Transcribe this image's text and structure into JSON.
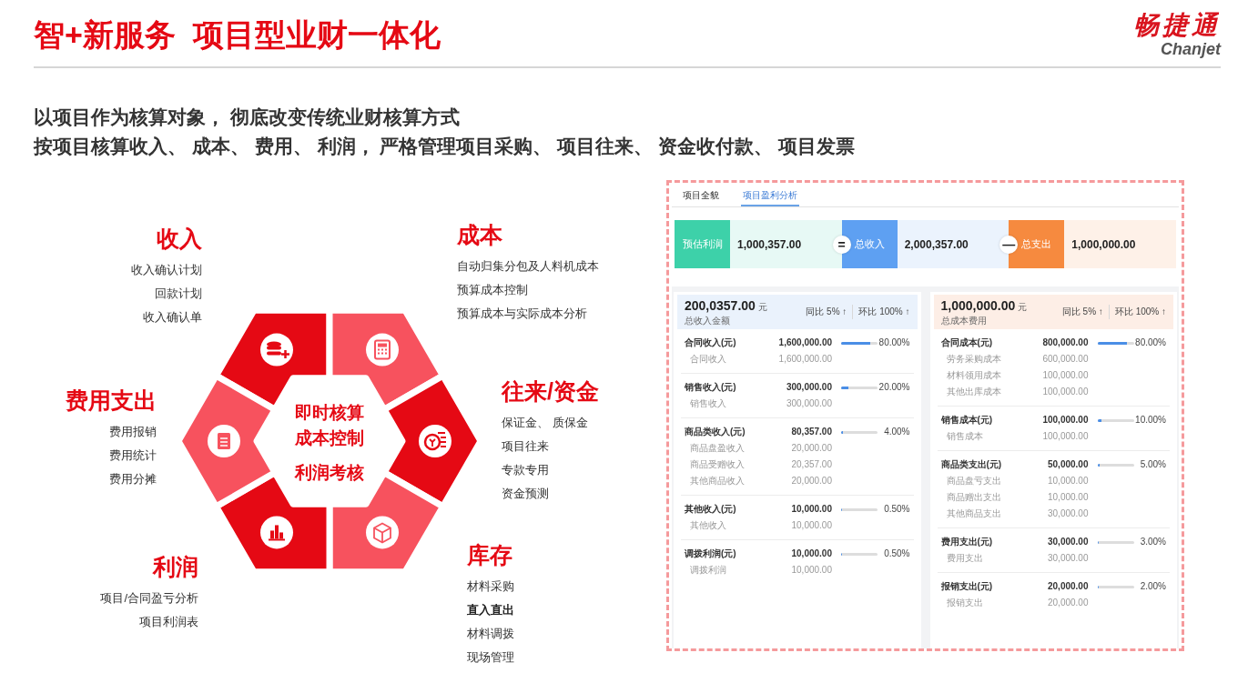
{
  "header": {
    "title": "智+新服务  项目型业财一体化",
    "logo_cn": "畅捷通",
    "logo_en": "Chanjet"
  },
  "subtitle": [
    "以项目作为核算对象， 彻底改变传统业财核算方式",
    "按项目核算收入、 成本、 费用、 利润， 严格管理项目采购、 项目往来、 资金收付款、 项目发票"
  ],
  "diagram": {
    "center": [
      "即时核算",
      "成本控制",
      "利润考核"
    ],
    "groups": [
      {
        "title": "收入",
        "items": [
          {
            "text": "收入确认计划"
          },
          {
            "text": "回款计划"
          },
          {
            "text": "收入确认单"
          }
        ]
      },
      {
        "title": "成本",
        "items": [
          {
            "text": "自动归集分包及人料机成本"
          },
          {
            "text": "预算成本控制"
          },
          {
            "text": "预算成本与实际成本分析"
          }
        ]
      },
      {
        "title": "往来/资金",
        "items": [
          {
            "text": "保证金、 质保金"
          },
          {
            "text": "项目往来"
          },
          {
            "text": "专款专用"
          },
          {
            "text": "资金预测"
          }
        ]
      },
      {
        "title": "库存",
        "items": [
          {
            "text": "材料采购",
            "emphasized": false
          },
          {
            "text": "直入直出",
            "emphasized": true
          },
          {
            "text": "材料调拨",
            "emphasized": false
          },
          {
            "text": "现场管理",
            "emphasized": false
          }
        ]
      },
      {
        "title": "利润",
        "items": [
          {
            "text": "项目/合同盈亏分析"
          },
          {
            "text": "项目利润表"
          }
        ]
      },
      {
        "title": "费用支出",
        "items": [
          {
            "text": "费用报销"
          },
          {
            "text": "费用统计"
          },
          {
            "text": "费用分摊"
          }
        ]
      }
    ]
  },
  "app": {
    "tabs": [
      {
        "label": "项目全貌",
        "selected": false
      },
      {
        "label": "项目盈利分析",
        "selected": true
      }
    ],
    "summary": [
      {
        "label": "预估利润",
        "value": "1,000,357.00",
        "color": "#3dd1a9"
      },
      {
        "label": "总收入",
        "value": "2,000,357.00",
        "color": "#5ea0f2",
        "operator": "="
      },
      {
        "label": "总支出",
        "value": "1,000,000.00",
        "color": "#f68a3f",
        "operator": "—"
      }
    ],
    "panels": [
      {
        "amount": "200,0357.00",
        "unit": "元",
        "caption": "总收入金额",
        "color": "#eaf2fc",
        "yoy": "同比 5% ↑",
        "mom": "环比 100% ↑",
        "groups": [
          {
            "title": "合同收入(元)",
            "total": "1,600,000.00",
            "level": 0.8,
            "share": "80.00%",
            "items": [
              {
                "label": "合同收入",
                "value": "1,600,000.00"
              }
            ]
          },
          {
            "title": "销售收入(元)",
            "total": "300,000.00",
            "level": 0.2,
            "share": "20.00%",
            "items": [
              {
                "label": "销售收入",
                "value": "300,000.00"
              }
            ]
          },
          {
            "title": "商品类收入(元)",
            "total": "80,357.00",
            "level": 0.04,
            "share": "4.00%",
            "items": [
              {
                "label": "商品盘盈收入",
                "value": "20,000.00"
              },
              {
                "label": "商品受赠收入",
                "value": "20,357.00"
              },
              {
                "label": "其他商品收入",
                "value": "20,000.00"
              }
            ]
          },
          {
            "title": "其他收入(元)",
            "total": "10,000.00",
            "level": 0.005,
            "share": "0.50%",
            "items": [
              {
                "label": "其他收入",
                "value": "10,000.00"
              }
            ]
          },
          {
            "title": "调拨利润(元)",
            "total": "10,000.00",
            "level": 0.005,
            "share": "0.50%",
            "items": [
              {
                "label": "调拨利润",
                "value": "10,000.00"
              }
            ]
          }
        ]
      },
      {
        "amount": "1,000,000.00",
        "unit": "元",
        "caption": "总成本费用",
        "color": "#fdeee6",
        "yoy": "同比 5% ↑",
        "mom": "环比 100% ↑",
        "groups": [
          {
            "title": "合同成本(元)",
            "total": "800,000.00",
            "level": 0.8,
            "share": "80.00%",
            "items": [
              {
                "label": "劳务采购成本",
                "value": "600,000.00"
              },
              {
                "label": "材料领用成本",
                "value": "100,000.00"
              },
              {
                "label": "其他出库成本",
                "value": "100,000.00"
              }
            ]
          },
          {
            "title": "销售成本(元)",
            "total": "100,000.00",
            "level": 0.1,
            "share": "10.00%",
            "items": [
              {
                "label": "销售成本",
                "value": "100,000.00"
              }
            ]
          },
          {
            "title": "商品类支出(元)",
            "total": "50,000.00",
            "level": 0.05,
            "share": "5.00%",
            "items": [
              {
                "label": "商品盘亏支出",
                "value": "10,000.00"
              },
              {
                "label": "商品赠出支出",
                "value": "10,000.00"
              },
              {
                "label": "其他商品支出",
                "value": "30,000.00"
              }
            ]
          },
          {
            "title": "费用支出(元)",
            "total": "30,000.00",
            "level": 0.03,
            "share": "3.00%",
            "items": [
              {
                "label": "费用支出",
                "value": "30,000.00"
              }
            ]
          },
          {
            "title": "报销支出(元)",
            "total": "20,000.00",
            "level": 0.02,
            "share": "2.00%",
            "items": [
              {
                "label": "报销支出",
                "value": "20,000.00"
              }
            ]
          }
        ]
      }
    ]
  }
}
